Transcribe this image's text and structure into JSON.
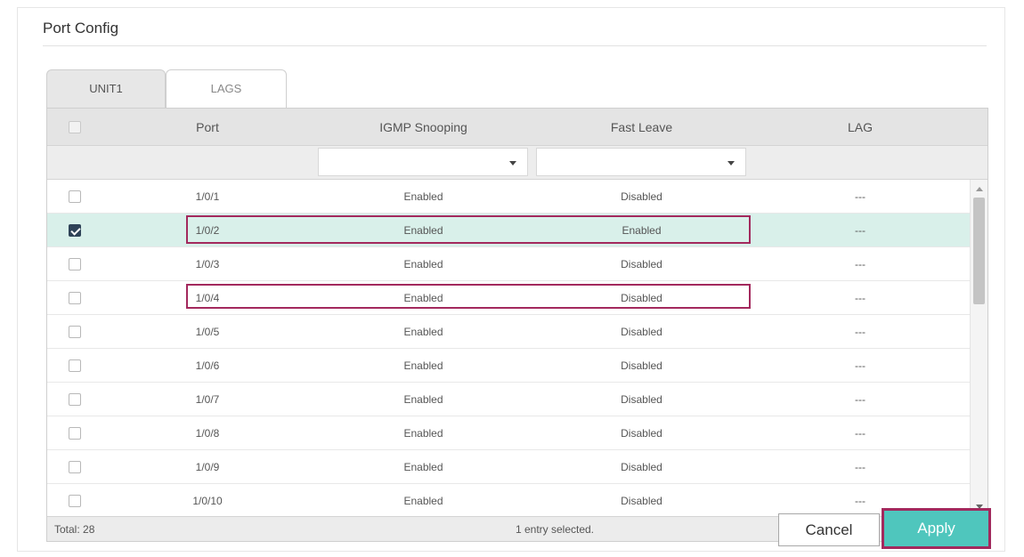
{
  "panel": {
    "title": "Port Config"
  },
  "tabs": [
    {
      "label": "UNIT1",
      "active": true
    },
    {
      "label": "LAGS",
      "active": false
    }
  ],
  "table": {
    "headers": {
      "port": "Port",
      "igmp": "IGMP Snooping",
      "fast_leave": "Fast Leave",
      "lag": "LAG"
    },
    "filter": {
      "igmp_value": "",
      "fast_leave_value": ""
    },
    "rows": [
      {
        "port": "1/0/1",
        "igmp": "Enabled",
        "fast_leave": "Disabled",
        "lag": "---",
        "checked": false
      },
      {
        "port": "1/0/2",
        "igmp": "Enabled",
        "fast_leave": "Enabled",
        "lag": "---",
        "checked": true
      },
      {
        "port": "1/0/3",
        "igmp": "Enabled",
        "fast_leave": "Disabled",
        "lag": "---",
        "checked": false
      },
      {
        "port": "1/0/4",
        "igmp": "Enabled",
        "fast_leave": "Disabled",
        "lag": "---",
        "checked": false
      },
      {
        "port": "1/0/5",
        "igmp": "Enabled",
        "fast_leave": "Disabled",
        "lag": "---",
        "checked": false
      },
      {
        "port": "1/0/6",
        "igmp": "Enabled",
        "fast_leave": "Disabled",
        "lag": "---",
        "checked": false
      },
      {
        "port": "1/0/7",
        "igmp": "Enabled",
        "fast_leave": "Disabled",
        "lag": "---",
        "checked": false
      },
      {
        "port": "1/0/8",
        "igmp": "Enabled",
        "fast_leave": "Disabled",
        "lag": "---",
        "checked": false
      },
      {
        "port": "1/0/9",
        "igmp": "Enabled",
        "fast_leave": "Disabled",
        "lag": "---",
        "checked": false
      },
      {
        "port": "1/0/10",
        "igmp": "Enabled",
        "fast_leave": "Disabled",
        "lag": "---",
        "checked": false
      }
    ],
    "footer": {
      "total": "Total: 28",
      "selected": "1 entry selected."
    }
  },
  "buttons": {
    "cancel": "Cancel",
    "apply": "Apply"
  },
  "colors": {
    "accent": "#4fc6bd",
    "highlight": "#a3295d",
    "selected_row": "#d9f0ea",
    "checkbox_checked": "#2f4358"
  }
}
